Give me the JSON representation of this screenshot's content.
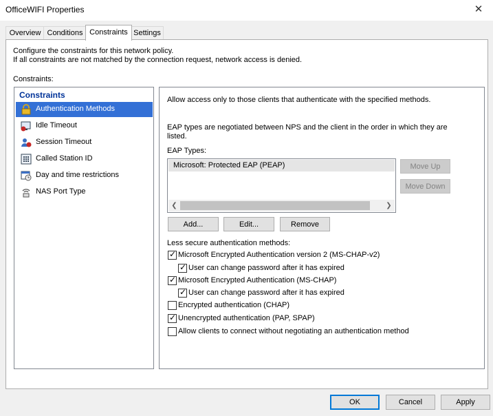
{
  "window": {
    "title": "OfficeWIFI Properties"
  },
  "tabs": [
    {
      "label": "Overview"
    },
    {
      "label": "Conditions"
    },
    {
      "label": "Constraints"
    },
    {
      "label": "Settings"
    }
  ],
  "intro": {
    "line1": "Configure the constraints for this network policy.",
    "line2": "If all constraints are not matched by the connection request, network access is denied."
  },
  "constraints_label": "Constraints:",
  "tree": {
    "root": "Constraints",
    "items": [
      {
        "label": "Authentication Methods",
        "icon": "lock-icon"
      },
      {
        "label": "Idle Timeout",
        "icon": "idle-timeout-icon"
      },
      {
        "label": "Session Timeout",
        "icon": "session-timeout-icon"
      },
      {
        "label": "Called Station ID",
        "icon": "called-station-icon"
      },
      {
        "label": "Day and time restrictions",
        "icon": "calendar-icon"
      },
      {
        "label": "NAS Port Type",
        "icon": "nas-port-icon"
      }
    ]
  },
  "details": {
    "allow_text": "Allow access only to those clients that authenticate with the specified methods.",
    "eap_note_line1": "EAP types are negotiated between NPS and the client in the order in which they are",
    "eap_note_line2": "listed.",
    "eap_types_label": "EAP Types:",
    "eap_types": [
      "Microsoft: Protected EAP (PEAP)"
    ],
    "buttons": {
      "move_up": "Move Up",
      "move_down": "Move Down",
      "add": "Add...",
      "edit": "Edit...",
      "remove": "Remove"
    },
    "less_secure_label": "Less secure authentication methods:",
    "methods": [
      {
        "label": "Microsoft Encrypted Authentication version 2 (MS-CHAP-v2)",
        "checked": true
      },
      {
        "label": "User can change password after it has expired",
        "checked": true
      },
      {
        "label": "Microsoft Encrypted Authentication (MS-CHAP)",
        "checked": true
      },
      {
        "label": "User can change password after it has expired",
        "checked": true
      },
      {
        "label": "Encrypted authentication (CHAP)",
        "checked": false
      },
      {
        "label": "Unencrypted authentication (PAP, SPAP)",
        "checked": true
      },
      {
        "label": "Allow clients to connect without negotiating an authentication method",
        "checked": false
      }
    ]
  },
  "footer": {
    "ok": "OK",
    "cancel": "Cancel",
    "apply": "Apply"
  },
  "colors": {
    "selection": "#3370d6",
    "tree_root": "#003399",
    "default_button_border": "#0078d7"
  }
}
